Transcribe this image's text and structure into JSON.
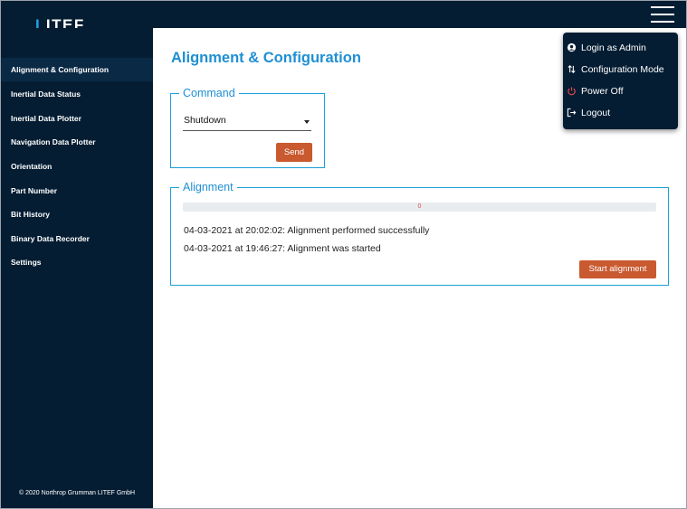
{
  "header": {
    "logo_accent": "L",
    "logo_rest": "ITEF",
    "menu_icon": "hamburger-menu-icon"
  },
  "sidebar": {
    "items": [
      {
        "label": "Alignment & Configuration",
        "active": true
      },
      {
        "label": "Inertial Data Status"
      },
      {
        "label": "Inertial Data Plotter"
      },
      {
        "label": "Navigation Data Plotter"
      },
      {
        "label": "Orientation"
      },
      {
        "label": "Part Number"
      },
      {
        "label": "Bit History"
      },
      {
        "label": "Binary Data Recorder"
      },
      {
        "label": "Settings"
      }
    ],
    "copyright": "© 2020 Northrop Grumman LITEF GmbH"
  },
  "main": {
    "title": "Alignment & Configuration",
    "command": {
      "legend": "Command",
      "selected": "Shutdown",
      "send_label": "Send"
    },
    "alignment": {
      "legend": "Alignment",
      "progress_value": 0,
      "progress_label": "0",
      "log": [
        "04-03-2021 at 20:02:02: Alignment performed successfully",
        "04-03-2021 at 19:46:27: Alignment was started"
      ],
      "start_label": "Start alignment"
    }
  },
  "user_menu": {
    "items": [
      {
        "label": "Login as Admin",
        "icon": "user-icon"
      },
      {
        "label": "Configuration Mode",
        "icon": "swap-arrows-icon"
      },
      {
        "label": "Power Off",
        "icon": "power-icon"
      },
      {
        "label": "Logout",
        "icon": "logout-icon"
      }
    ]
  },
  "colors": {
    "navy": "#041d33",
    "accent_blue": "#1f8fd3",
    "button_orange": "#c9592f",
    "power_red": "#e0474c"
  }
}
